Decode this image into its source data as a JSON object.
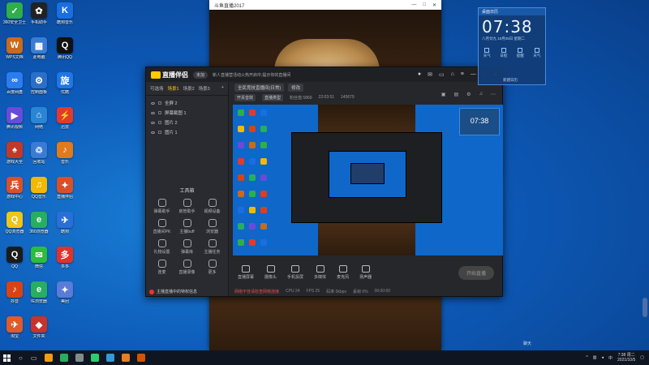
{
  "desktop": {
    "icons": [
      {
        "label": "360安全卫士",
        "color": "#2fae4a",
        "glyph": "✓"
      },
      {
        "label": "手机助手",
        "color": "#222222",
        "glyph": "✿"
      },
      {
        "label": "酷狗音乐",
        "color": "#1a6fe0",
        "glyph": "K"
      },
      {
        "label": "WPS文档",
        "color": "#c96a1c",
        "glyph": "W"
      },
      {
        "label": "此电脑",
        "color": "#3a7bd5",
        "glyph": "▦"
      },
      {
        "label": "腾讯QQ",
        "color": "#111111",
        "glyph": "Q"
      },
      {
        "label": "百度网盘",
        "color": "#2a7cf0",
        "glyph": "∞"
      },
      {
        "label": "控制面板",
        "color": "#2b6fc9",
        "glyph": "⚙"
      },
      {
        "label": "优酷",
        "color": "#1f76e8",
        "glyph": "旋"
      },
      {
        "label": "腾讯视频",
        "color": "#6a4bd8",
        "glyph": "▶"
      },
      {
        "label": "网络",
        "color": "#2a86d4",
        "glyph": "⌂"
      },
      {
        "label": "迅雷",
        "color": "#e23a2a",
        "glyph": "⚡"
      },
      {
        "label": "游戏大全",
        "color": "#c0392b",
        "glyph": "♠"
      },
      {
        "label": "回收站",
        "color": "#3a7bd5",
        "glyph": "♲"
      },
      {
        "label": "音乐",
        "color": "#e07a1c",
        "glyph": "♪"
      },
      {
        "label": "游戏中心",
        "color": "#d94f2a",
        "glyph": "兵"
      },
      {
        "label": "QQ音乐",
        "color": "#f5b800",
        "glyph": "♫"
      },
      {
        "label": "直播伴侣",
        "color": "#d8502a",
        "glyph": "✦"
      },
      {
        "label": "QQ浏览器",
        "color": "#f0c419",
        "glyph": "Q"
      },
      {
        "label": "360浏览器",
        "color": "#27ae60",
        "glyph": "e"
      },
      {
        "label": "酷狗",
        "color": "#2a6fd8",
        "glyph": "✈"
      },
      {
        "label": "QQ",
        "color": "#1b1b1b",
        "glyph": "Q"
      },
      {
        "label": "微信",
        "color": "#2ebd3b",
        "glyph": "✉"
      },
      {
        "label": "多多",
        "color": "#e5302a",
        "glyph": "多"
      },
      {
        "label": "抖音",
        "color": "#d84315",
        "glyph": "♪"
      },
      {
        "label": "IE浏览器",
        "color": "#27ae60",
        "glyph": "e"
      },
      {
        "label": "美团",
        "color": "#5a7bd8",
        "glyph": "✦"
      },
      {
        "label": "淘宝",
        "color": "#e05a2a",
        "glyph": "✈"
      },
      {
        "label": "文件夹",
        "color": "#c9332a",
        "glyph": "◆"
      }
    ]
  },
  "video_window": {
    "title": "斗鱼直播2017",
    "min": "—",
    "max": "□",
    "close": "✕"
  },
  "app": {
    "logo": "直播伴侣",
    "badge": "未加",
    "notice": "新人直播营活动火热开启中,提示你的直播间",
    "tabs": [
      "可选场",
      "场景1",
      "场景2",
      "场景3"
    ],
    "active_tab_index": 1,
    "scenes": [
      "全屏 2",
      "屏幕截图 1",
      "图片 2",
      "图片 1"
    ],
    "toolbox_title": "工具箱",
    "tools": [
      "弹幕助手",
      "房管助手",
      "视频设备",
      "直播间PK",
      "主播buff",
      "浏览器",
      "礼物设置",
      "弹幕库",
      "主播任务",
      "连麦",
      "直播录像",
      "更多"
    ],
    "footer_notice": "主播直播中的特权信息",
    "main_head": {
      "channel": "全民竞技直播间(日常)",
      "pill": "修改"
    },
    "main_sub": {
      "pill1": "开关音效",
      "pill2": "直播类型",
      "info1": "粉丝值 5869",
      "info2": "22:03:51",
      "info3": "145679"
    },
    "preview_clock": "07:38",
    "bottom_tools": [
      "直播屏幕",
      "摄像头",
      "手机投屏",
      "多媒体",
      "麦克风",
      "扬声器"
    ],
    "go_live": "开始直播",
    "status": {
      "warn": "网络不佳请检查网络连接",
      "cpu": "CPU 24",
      "fps": "FPS 25",
      "bitrate": "码率 0kbps",
      "drop": "丢帧 0%",
      "time": "00:00:00"
    }
  },
  "clock_widget": {
    "header": "桌面日历",
    "time": "07:38",
    "date": "八月廿九 10月05日 星期二",
    "items": [
      "天气",
      "日程",
      "提醒",
      "天气"
    ],
    "footer": "新建日历"
  },
  "side_label": "聊天",
  "taskbar": {
    "time": "7:38 周二",
    "date": "2021/10/5",
    "apps": [
      "#f39c12",
      "#27ae60",
      "#7f8c8d",
      "#2ecc71",
      "#3498db",
      "#e67e22",
      "#d35400"
    ]
  }
}
